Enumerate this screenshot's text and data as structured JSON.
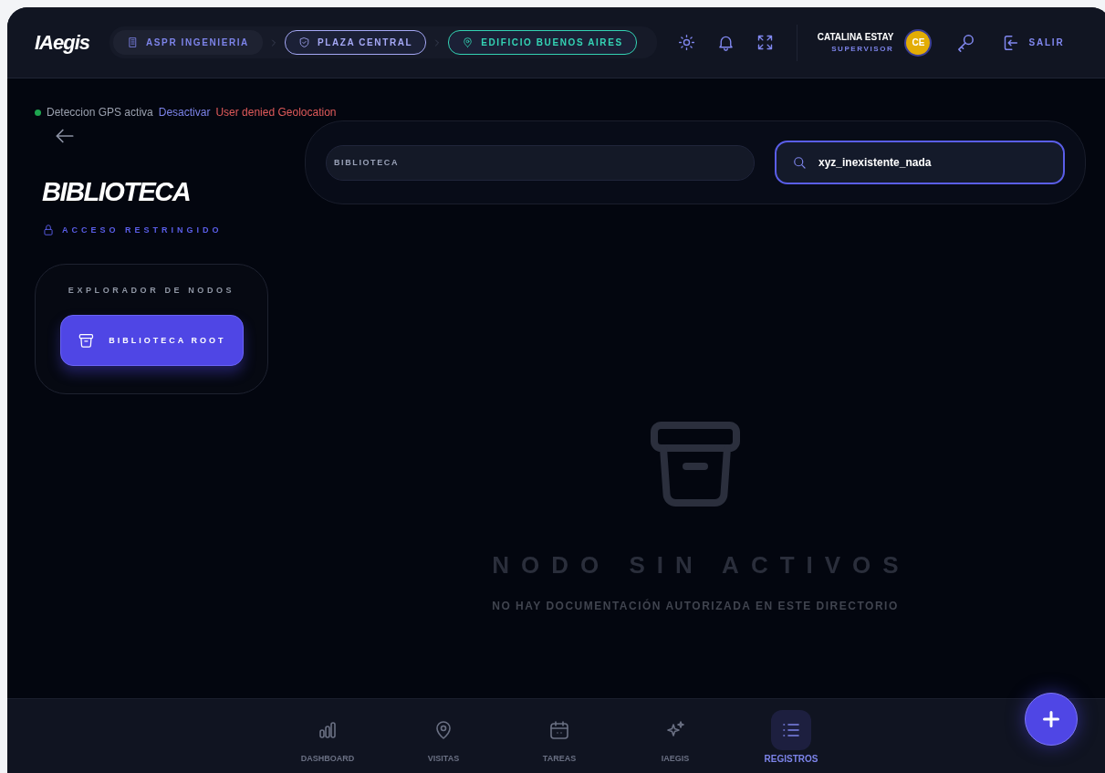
{
  "header": {
    "logo": "IAegis",
    "breadcrumbs": [
      {
        "label": "ASPR INGENIERIA",
        "kind": "building",
        "color": "#7c83e8",
        "outlined": false
      },
      {
        "label": "PLAZA CENTRAL",
        "kind": "shield",
        "color": "#a5a8f5",
        "outlined": true
      },
      {
        "label": "EDIFICIO BUENOS AIRES",
        "kind": "pin",
        "color": "#34d3b4",
        "outlined": true
      }
    ],
    "user": {
      "name": "CATALINA ESTAY",
      "role": "SUPERVISOR",
      "initials": "CE"
    },
    "logout": "SALIR"
  },
  "gps": {
    "active": true,
    "label": "Deteccion GPS activa",
    "action": "Desactivar",
    "error": "User denied Geolocation"
  },
  "title": "BIBLIOTECA",
  "access": "ACCESO RESTRINGIDO",
  "explorer": {
    "heading": "EXPLORADOR DE NODOS",
    "nodes": [
      {
        "label": "BIBLIOTECA ROOT",
        "selected": true
      }
    ]
  },
  "path_field": {
    "value": "BIBLIOTECA"
  },
  "search": {
    "value": "xyz_inexistente_nada",
    "focused": true
  },
  "empty": {
    "title": "NODO SIN ACTIVOS",
    "subtitle": "NO HAY DOCUMENTACIÓN AUTORIZADA EN ESTE DIRECTORIO"
  },
  "nav": [
    {
      "label": "DASHBOARD",
      "kind": "chart",
      "selected": false
    },
    {
      "label": "VISITAS",
      "kind": "pin",
      "selected": false
    },
    {
      "label": "TAREAS",
      "kind": "calendar",
      "selected": false
    },
    {
      "label": "IAEGIS",
      "kind": "sparkle",
      "selected": false
    },
    {
      "label": "REGISTROS",
      "kind": "list",
      "selected": true
    }
  ]
}
